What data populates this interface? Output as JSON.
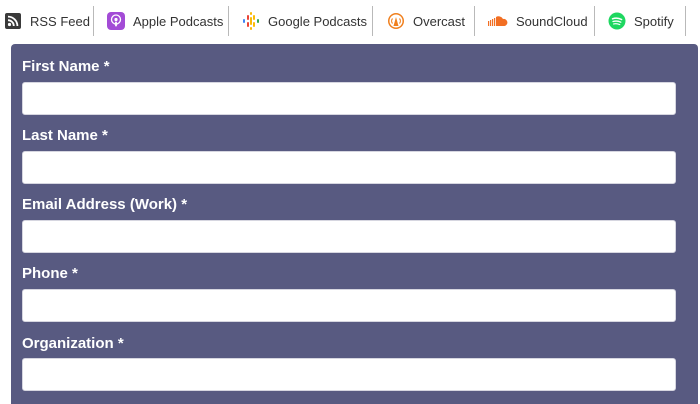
{
  "podcast_links": [
    {
      "label": "RSS Feed",
      "icon": "rss-icon"
    },
    {
      "label": "Apple Podcasts",
      "icon": "apple-podcasts-icon"
    },
    {
      "label": "Google Podcasts",
      "icon": "google-podcasts-icon"
    },
    {
      "label": "Overcast",
      "icon": "overcast-icon"
    },
    {
      "label": "SoundCloud",
      "icon": "soundcloud-icon"
    },
    {
      "label": "Spotify",
      "icon": "spotify-icon"
    }
  ],
  "form": {
    "fields": [
      {
        "label": "First Name *",
        "value": "",
        "placeholder": ""
      },
      {
        "label": "Last Name *",
        "value": "",
        "placeholder": ""
      },
      {
        "label": "Email Address (Work) *",
        "value": "",
        "placeholder": ""
      },
      {
        "label": "Phone *",
        "value": "",
        "placeholder": ""
      },
      {
        "label": "Organization *",
        "value": "",
        "placeholder": ""
      }
    ]
  },
  "colors": {
    "form_background": "#585a81",
    "rss": "#3a3a3a",
    "apple_podcasts": "#a34bd6",
    "overcast": "#f07f1d",
    "soundcloud": "#f26f23",
    "spotify": "#1ed760"
  }
}
